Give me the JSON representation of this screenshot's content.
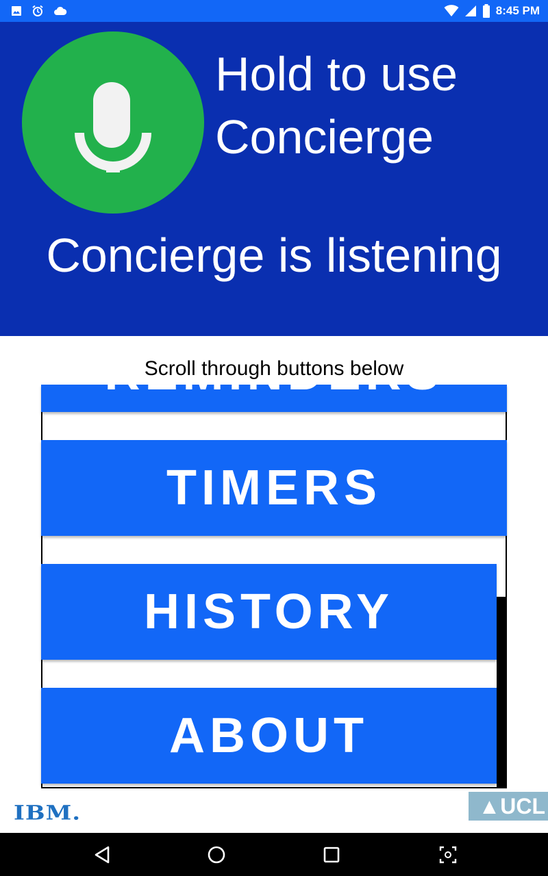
{
  "status_bar": {
    "time": "8:45 PM",
    "left_icons": [
      "image-icon",
      "alarm-icon",
      "cloud-icon"
    ],
    "right_icons": [
      "wifi-icon",
      "signal-icon",
      "battery-icon"
    ]
  },
  "header": {
    "title": "Hold to use Concierge",
    "status": "Concierge is listening",
    "mic_icon": "microphone-icon"
  },
  "list": {
    "hint": "Scroll through buttons below",
    "buttons": [
      {
        "label": "REMINDERS"
      },
      {
        "label": "TIMERS"
      },
      {
        "label": "HISTORY"
      },
      {
        "label": "ABOUT"
      }
    ]
  },
  "logos": {
    "left": "IBM.",
    "right": "▲UCL"
  },
  "colors": {
    "status_bar": "#1267f7",
    "header": "#0a2fb0",
    "mic_button": "#22b14c",
    "menu_button": "#1267f7"
  },
  "nav_bar": {
    "icons": [
      "back-icon",
      "home-icon",
      "recents-icon",
      "screenshot-icon"
    ]
  }
}
